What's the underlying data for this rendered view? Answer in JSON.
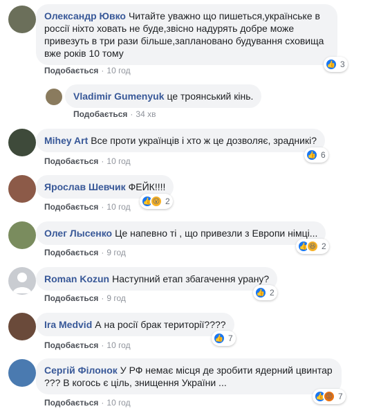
{
  "like_label": "Подобається",
  "comments": [
    {
      "author": "Олександр Ювко",
      "text": "Читайте уважно що пишеться,українське в россії ніхто ховать не буде,звісно надурять добре може привезуть в три рази більше,заплановано будування сховища вже років 10 тому",
      "time": "10 год",
      "reactions": [
        "like"
      ],
      "reaction_count": "3",
      "avatar_color": "#6b6f5a"
    },
    {
      "author": "Vladimir Gumenyuk",
      "text": "це троянський кінь.",
      "time": "34 хв",
      "reactions": [],
      "reaction_count": "",
      "avatar_color": "#8a7b5e"
    },
    {
      "author": "Mihey Art",
      "text": "Все проти українців і хто ж це дозволяє, зрадникі?",
      "time": "10 год",
      "reactions": [
        "like"
      ],
      "reaction_count": "6",
      "avatar_color": "#3e4a3a"
    },
    {
      "author": "Ярослав Шевчик",
      "text": "ФЕЙК!!!!",
      "time": "10 год",
      "reactions": [
        "like",
        "wow"
      ],
      "reaction_count": "2",
      "avatar_color": "#8c5a48"
    },
    {
      "author": "Олег Лысенко",
      "text": "Це напевно ті , що привезли з Европи німці...",
      "time": "9 год",
      "reactions": [
        "like",
        "haha"
      ],
      "reaction_count": "2",
      "avatar_color": "#7a8c5e"
    },
    {
      "author": "Roman Kozun",
      "text": "Наступний етап збагачення урану?",
      "time": "9 год",
      "reactions": [
        "like"
      ],
      "reaction_count": "2",
      "avatar_color": "#c9ccd1"
    },
    {
      "author": "Ira Medvid",
      "text": "А на росії брак території????",
      "time": "10 год",
      "reactions": [
        "like"
      ],
      "reaction_count": "7",
      "avatar_color": "#6a4a3a"
    },
    {
      "author": "Сергій Філонок",
      "text": "У РФ немає місця де зробити ядерний цвинтар ??? В когось є ціль, знищення України ...",
      "time": "10 год",
      "reactions": [
        "like",
        "angry"
      ],
      "reaction_count": "7",
      "avatar_color": "#4a7ab0"
    }
  ]
}
